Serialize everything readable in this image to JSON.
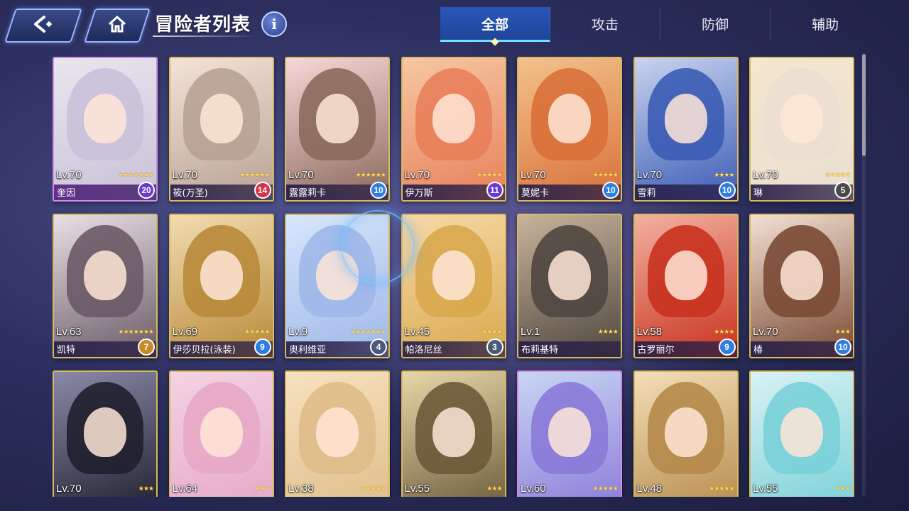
{
  "header": {
    "title": "冒险者列表",
    "info_label": "i",
    "back_icon": "back-arrow-icon",
    "home_icon": "home-icon"
  },
  "tabs": [
    {
      "label": "全部",
      "active": true
    },
    {
      "label": "攻击",
      "active": false
    },
    {
      "label": "防御",
      "active": false
    },
    {
      "label": "辅助",
      "active": false
    }
  ],
  "cards": [
    {
      "name": "奎因",
      "level": "Lv.70",
      "stars": "★★★★★★★",
      "badge": "20",
      "frame": "purple",
      "badge_color": "#6a3ad0",
      "palette": [
        "#e9e6ee",
        "#c9c1d8"
      ]
    },
    {
      "name": "筱(万圣)",
      "level": "Lv.70",
      "stars": "★★★★★★",
      "badge": "14",
      "frame": "gold",
      "badge_color": "#d8324a",
      "palette": [
        "#f3e2d6",
        "#b8a295"
      ]
    },
    {
      "name": "露露莉卡",
      "level": "Lv.70",
      "stars": "★★★★★★",
      "badge": "10",
      "frame": "gold",
      "badge_color": "#2d7ee0",
      "palette": [
        "#f7d7d8",
        "#8a6a5c"
      ]
    },
    {
      "name": "伊万斯",
      "level": "Lv.70",
      "stars": "★★★★★",
      "badge": "11",
      "frame": "gold",
      "badge_color": "#6a3ad0",
      "palette": [
        "#f6c7a3",
        "#e8805a"
      ]
    },
    {
      "name": "莫妮卡",
      "level": "Lv.70",
      "stars": "★★★★★",
      "badge": "10",
      "frame": "gold",
      "badge_color": "#2d7ee0",
      "palette": [
        "#f2c28a",
        "#d9703a"
      ]
    },
    {
      "name": "雪莉",
      "level": "Lv.70",
      "stars": "★★★★",
      "badge": "10",
      "frame": "gold",
      "badge_color": "#2d7ee0",
      "palette": [
        "#c9d3ef",
        "#3b5cb5"
      ]
    },
    {
      "name": "琳",
      "level": "Lv.70",
      "stars": "★★★★★",
      "badge": "5",
      "frame": "gold",
      "badge_color": "#4a4a4a",
      "palette": [
        "#f4e7cf",
        "#eadfd0"
      ]
    },
    {
      "name": "凯特",
      "level": "Lv.63",
      "stars": "★★★★★★★",
      "badge": "7",
      "frame": "gold",
      "badge_color": "#c98a2a",
      "palette": [
        "#e8e0e4",
        "#6a5a66"
      ]
    },
    {
      "name": "伊莎贝拉(泳装)",
      "level": "Lv.69",
      "stars": "★★★★★",
      "badge": "9",
      "frame": "gold",
      "badge_color": "#2d7ee0",
      "palette": [
        "#f2dcb0",
        "#b88a3a"
      ]
    },
    {
      "name": "奥利维亚",
      "level": "Lv.9",
      "stars": "★★★★★★★",
      "badge": "4",
      "frame": "gold",
      "badge_color": "#4a5a7a",
      "palette": [
        "#d6e6fb",
        "#9fb8e8"
      ]
    },
    {
      "name": "帕洛尼丝",
      "level": "Lv.45",
      "stars": "★★★★",
      "badge": "3",
      "frame": "gold",
      "badge_color": "#4a5a7a",
      "palette": [
        "#f7d9a8",
        "#d8a94e"
      ]
    },
    {
      "name": "布莉基特",
      "level": "Lv.1",
      "stars": "★★★★",
      "badge": "",
      "frame": "gold",
      "badge_color": "#4a4a4a",
      "palette": [
        "#c7b39a",
        "#4f4740"
      ]
    },
    {
      "name": "古罗丽尔",
      "level": "Lv.58",
      "stars": "★★★★",
      "badge": "9",
      "frame": "gold",
      "badge_color": "#2d7ee0",
      "palette": [
        "#f3b0a0",
        "#c8321e"
      ]
    },
    {
      "name": "椿",
      "level": "Lv.70",
      "stars": "★★★",
      "badge": "10",
      "frame": "gold",
      "badge_color": "#2d7ee0",
      "palette": [
        "#f2e0d2",
        "#7a4a34"
      ]
    },
    {
      "name": "",
      "level": "Lv.70",
      "stars": "★★★",
      "badge": "",
      "frame": "gold",
      "badge_color": "#4a4a4a",
      "palette": [
        "#8a8aa8",
        "#1f1f2e"
      ]
    },
    {
      "name": "",
      "level": "Lv.64",
      "stars": "★★★",
      "badge": "",
      "frame": "gold",
      "badge_color": "#4a4a4a",
      "palette": [
        "#f3d3e2",
        "#e7a8c6"
      ]
    },
    {
      "name": "",
      "level": "Lv.38",
      "stars": "★★★★★",
      "badge": "",
      "frame": "gold",
      "badge_color": "#4a4a4a",
      "palette": [
        "#f6e2bf",
        "#dfbd8a"
      ]
    },
    {
      "name": "",
      "level": "Lv.55",
      "stars": "★★★",
      "badge": "",
      "frame": "gold",
      "badge_color": "#4a4a4a",
      "palette": [
        "#e8d6a8",
        "#6b5a3a"
      ]
    },
    {
      "name": "",
      "level": "Lv.60",
      "stars": "★★★★★",
      "badge": "",
      "frame": "purple",
      "badge_color": "#4a4a4a",
      "palette": [
        "#c8d6f3",
        "#8a7ad8"
      ]
    },
    {
      "name": "",
      "level": "Lv.48",
      "stars": "★★★★★",
      "badge": "",
      "frame": "gold",
      "badge_color": "#4a4a4a",
      "palette": [
        "#f3dfb8",
        "#b58a4a"
      ]
    },
    {
      "name": "",
      "level": "Lv.55",
      "stars": "★★★",
      "badge": "",
      "frame": "gold",
      "badge_color": "#4a4a4a",
      "palette": [
        "#d8f2f4",
        "#7ad0d8"
      ]
    }
  ]
}
